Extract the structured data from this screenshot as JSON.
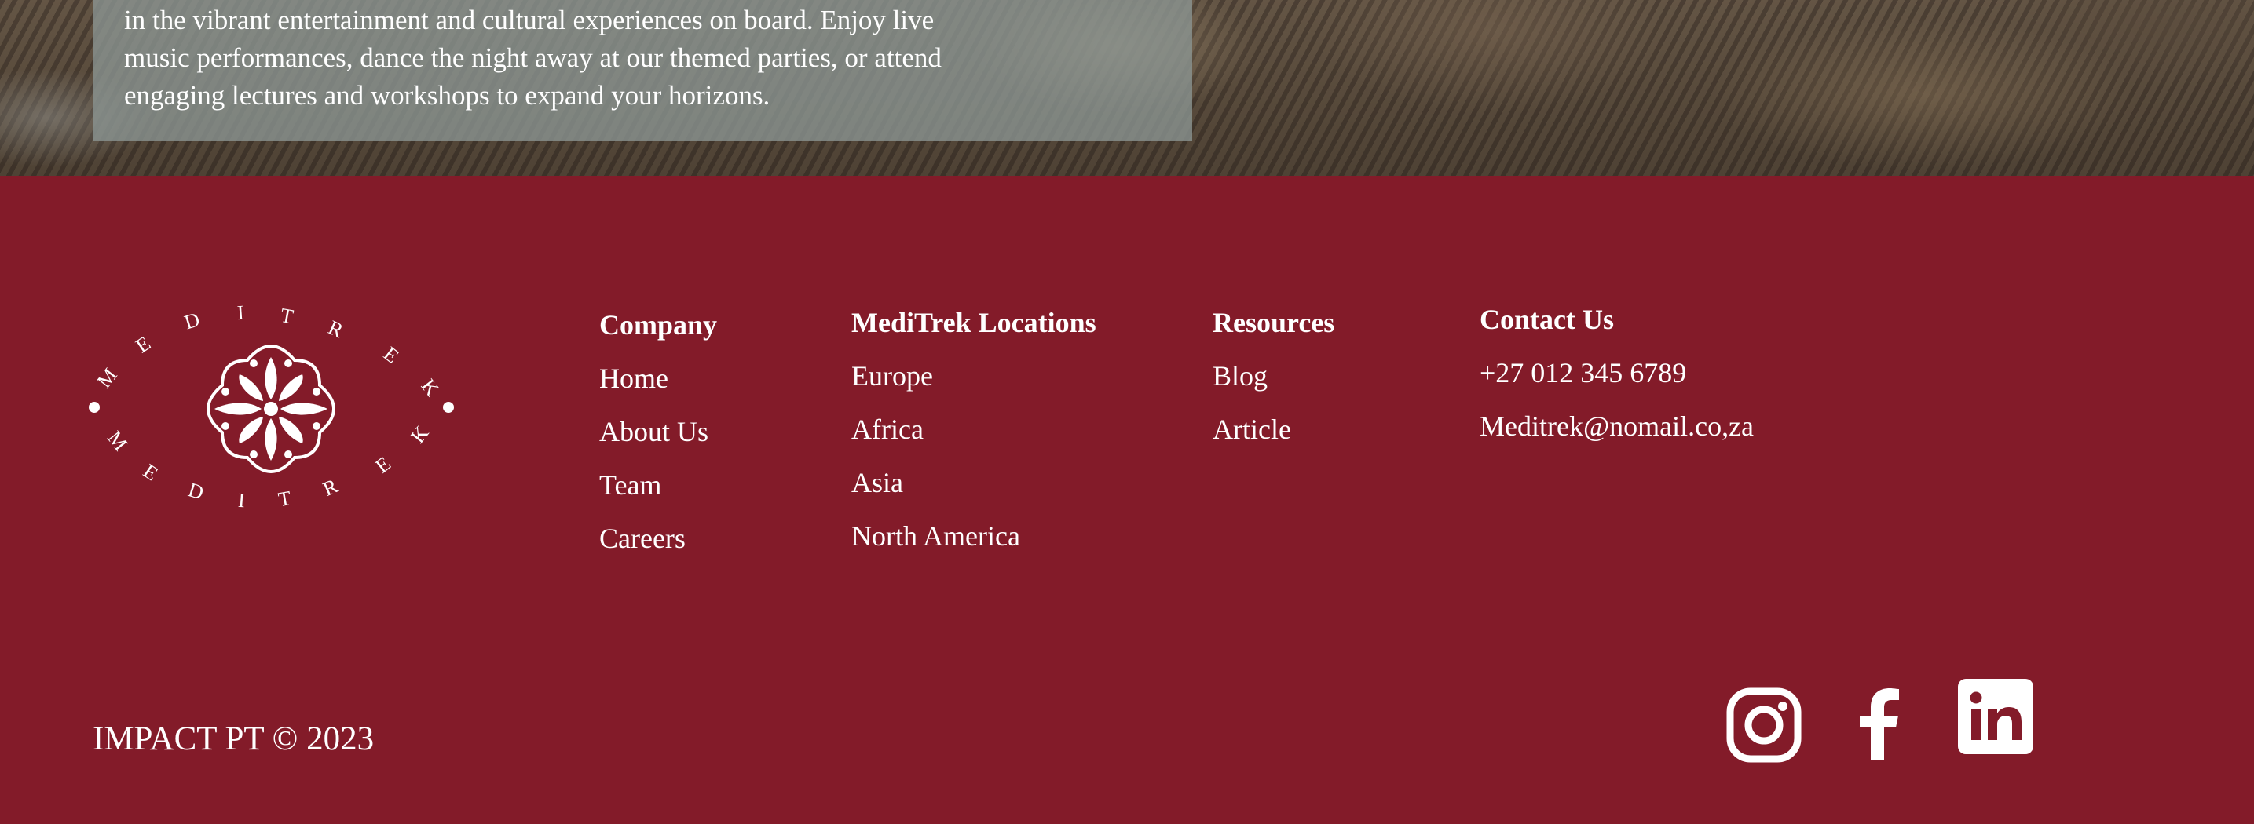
{
  "hero": {
    "caption_lines": "in the vibrant entertainment and cultural experiences on board. Enjoy live\nmusic performances, dance the night away at our themed parties, or attend\nengaging lectures and workshops to expand your horizons."
  },
  "logo": {
    "ring_text_top": "MEDITREK",
    "ring_text_bottom": "MEDITREK"
  },
  "footer": {
    "columns": [
      {
        "heading": "Company",
        "links": [
          "Home",
          "About Us",
          "Team",
          "Careers"
        ]
      },
      {
        "heading": "MediTrek Locations",
        "links": [
          "Europe",
          "Africa",
          "Asia",
          "North America"
        ]
      },
      {
        "heading": "Resources",
        "links": [
          "Blog",
          "Article"
        ]
      },
      {
        "heading": "Contact Us",
        "links": [
          "+27 012 345 6789",
          "Meditrek@nomail.co,za"
        ]
      }
    ],
    "copyright": "IMPACT PT © 2023",
    "social": {
      "icons": [
        "instagram-icon",
        "facebook-icon",
        "linkedin-icon"
      ],
      "color": "#ffffff"
    }
  },
  "colors": {
    "footer_bg": "#831b29",
    "text": "#ffffff",
    "caption_bg": "#8c9694"
  }
}
